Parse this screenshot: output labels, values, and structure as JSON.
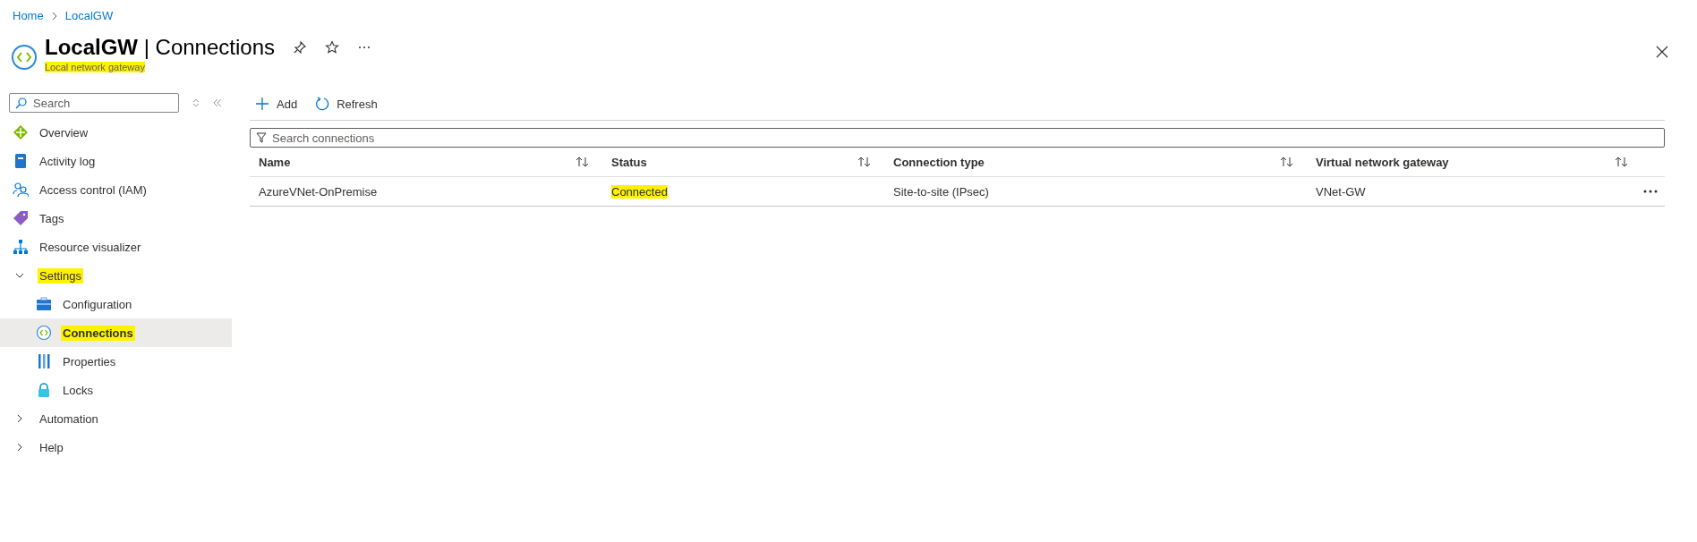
{
  "breadcrumb": [
    {
      "label": "Home"
    },
    {
      "label": "LocalGW"
    }
  ],
  "header": {
    "resource": "LocalGW",
    "separator": "|",
    "page": "Connections",
    "subtitle": "Local network gateway",
    "subtitle_highlighted": true
  },
  "sidebar": {
    "search": {
      "placeholder": "Search"
    },
    "items": [
      {
        "label": "Overview",
        "selected": false
      },
      {
        "label": "Activity log",
        "selected": false
      },
      {
        "label": "Access control (IAM)",
        "selected": false
      },
      {
        "label": "Tags",
        "selected": false
      },
      {
        "label": "Resource visualizer",
        "selected": false
      },
      {
        "label": "Settings",
        "selected": false,
        "expanded": true,
        "highlighted": true,
        "children": [
          {
            "label": "Configuration",
            "selected": false,
            "highlighted": false
          },
          {
            "label": "Connections",
            "selected": true,
            "highlighted": true
          },
          {
            "label": "Properties",
            "selected": false,
            "highlighted": false
          },
          {
            "label": "Locks",
            "selected": false,
            "highlighted": false
          }
        ]
      },
      {
        "label": "Automation",
        "selected": false,
        "expanded": false
      },
      {
        "label": "Help",
        "selected": false,
        "expanded": false
      }
    ]
  },
  "toolbar": [
    {
      "label": "Add",
      "kind": "add"
    },
    {
      "label": "Refresh",
      "kind": "refresh"
    }
  ],
  "filter": {
    "placeholder": "Search connections"
  },
  "table": {
    "columns": [
      "Name",
      "Status",
      "Connection type",
      "Virtual network gateway"
    ],
    "rows": [
      {
        "cells": [
          {
            "text": "AzureVNet-OnPremise",
            "highlighted": false
          },
          {
            "text": "Connected",
            "highlighted": true
          },
          {
            "text": "Site-to-site (IPsec)",
            "highlighted": false
          },
          {
            "text": "VNet-GW",
            "highlighted": false
          }
        ]
      }
    ]
  }
}
